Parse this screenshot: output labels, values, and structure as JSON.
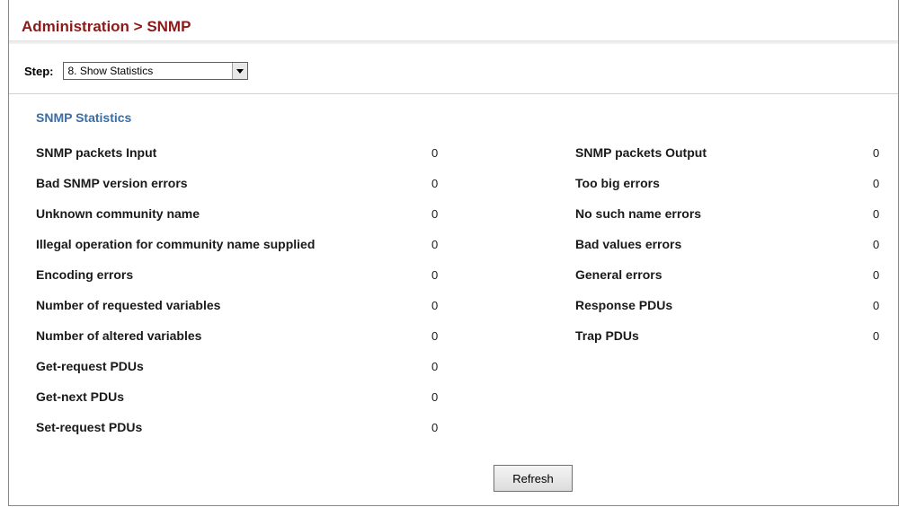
{
  "header": {
    "title": "Administration > SNMP"
  },
  "step": {
    "label": "Step:",
    "selected": "8. Show Statistics",
    "icon": "chevron-down-icon"
  },
  "section": {
    "title": "SNMP Statistics"
  },
  "stats_left": [
    {
      "label": "SNMP packets Input",
      "value": "0"
    },
    {
      "label": "Bad SNMP version errors",
      "value": "0"
    },
    {
      "label": "Unknown community name",
      "value": "0"
    },
    {
      "label": "Illegal operation for community name supplied",
      "value": "0"
    },
    {
      "label": "Encoding errors",
      "value": "0"
    },
    {
      "label": "Number of requested variables",
      "value": "0"
    },
    {
      "label": "Number of altered variables",
      "value": "0"
    },
    {
      "label": "Get-request PDUs",
      "value": "0"
    },
    {
      "label": "Get-next PDUs",
      "value": "0"
    },
    {
      "label": "Set-request PDUs",
      "value": "0"
    }
  ],
  "stats_right": [
    {
      "label": "SNMP packets Output",
      "value": "0"
    },
    {
      "label": "Too big errors",
      "value": "0"
    },
    {
      "label": "No such name errors",
      "value": "0"
    },
    {
      "label": "Bad values errors",
      "value": "0"
    },
    {
      "label": "General errors",
      "value": "0"
    },
    {
      "label": "Response PDUs",
      "value": "0"
    },
    {
      "label": "Trap PDUs",
      "value": "0"
    }
  ],
  "buttons": {
    "refresh": "Refresh"
  },
  "colors": {
    "title": "#8b1a1a",
    "section_title": "#3a6ea5"
  }
}
